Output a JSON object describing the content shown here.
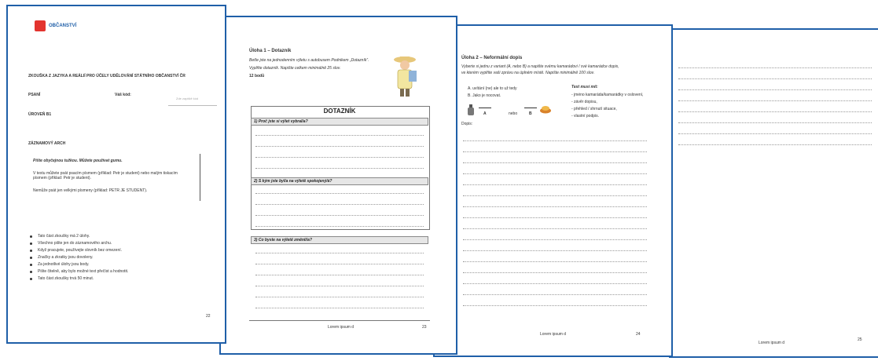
{
  "page1": {
    "logo_text": "OBČANSTVÍ",
    "exam_title": "ZKOUŠKA Z JAZYKA A REÁLIÍ PRO ÚČELY UDĚLOVÁNÍ STÁTNÍHO OBČANSTVÍ ČR",
    "section_label": "PSANÍ",
    "code_label": "Váš kód:",
    "code_placeholder": "Zde zapiště kód",
    "level_label": "ÚROVEŇ B1",
    "answer_sheet_label": "ZÁZNAMOVÝ ARCH",
    "instr_1": "Píšte obyčejnou tužkou. Můžete používat gumu.",
    "instr_2": "V textu můžete psát psacím písmem (příklad: Petr je student) nebo malým tiskacím písmem (příklad: Petr je student).",
    "instr_3": "Nemůže psát jen velkými písmeny (příklad: PETR JE STUDENT).",
    "bullets": [
      "Tato část zkoušky má 2 úlohy.",
      "Všechno pište jen do záznamového archu.",
      "Když pracujete, používejte slovník bez omezení.",
      "Značky a zkratky jsou dovoleny.",
      "Za jednotlivé úlohy jsou body.",
      "Pište čitelně, aby bylo možné text přečíst a hodnotit.",
      "Tato část zkoušky trvá 50 minut."
    ],
    "page_number": "22"
  },
  "page2": {
    "task_title": "Úloha 1 – Dotazník",
    "task_instr_1": "Beťte jste na jednodenním výletu s autobusem Podnikem „Dotazník“.",
    "task_instr_2": "Vyplňte dotazník. Napište celkem minimálně 25 slov.",
    "task_points": "12 bodů",
    "form_title": "DOTAZNÍK",
    "q1": "1) Proč jste si výlet vybral/a?",
    "q2": "2) S kým jste byl/a na výletě spokojený/á?",
    "q3": "3) Co byste na výletě změnil/a?",
    "footer": "Lorem ipsum d",
    "page_number": "23"
  },
  "page3": {
    "task_title": "Úloha 2 – Neformální dopis",
    "task_instr_1": "Vyberte si jednu z variant (A, nebo B) a napište svému kamarádovi / své kamarádce dopis,",
    "task_instr_2": "ve kterém vyplňte vaši zprávu na úplném místě. Napište minimálně 100 slov.",
    "option_a": "A. uvítání (ne) ale to už tedy",
    "option_b": "B. Jako je nocovat.",
    "right_head": "Text musí mít:",
    "right_items": [
      "- jméno kamaráda/kamarádky v oslovení,",
      "- závěr dopisu,",
      "- přehled / shrnutí situace,",
      "- vlastní podpis."
    ],
    "choice_a": "A",
    "choice_or": "nebo",
    "choice_b": "B",
    "letter_label": "Dopis:",
    "footer": "Lorem ipsum d",
    "page_number": "24"
  },
  "page4": {
    "footer": "Lorem ipsum d",
    "page_number": "25"
  }
}
